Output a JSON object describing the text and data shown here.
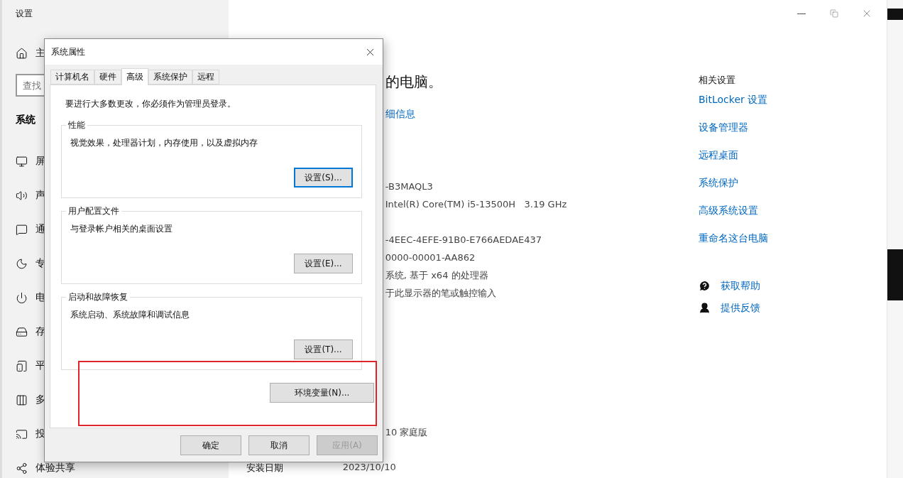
{
  "settings_window": {
    "title": "设置",
    "home_label": "主",
    "search": {
      "placeholder": "查找"
    },
    "section": "系统",
    "nav_items": [
      "屏",
      "声",
      "通",
      "专",
      "电",
      "存",
      "平",
      "多",
      "投",
      "体验共享"
    ],
    "heading": "的电脑。",
    "details_link": "细信息",
    "spec_groups": [
      [
        "-B3MAQL3",
        "Intel(R) Core(TM) i5-13500H   3.19 GHz"
      ],
      [
        "-4EEC-4EFE-91B0-E766AEDAE437",
        "0000-00001-AA862",
        "系统, 基于 x64 的处理器",
        "于此显示器的笔或触控输入"
      ],
      [
        "10 家庭版"
      ]
    ],
    "install_date": {
      "label": "安装日期",
      "value": "2023/10/10"
    },
    "related_title": "相关设置",
    "related_links": [
      "BitLocker 设置",
      "设备管理器",
      "远程桌面",
      "系统保护",
      "高级系统设置",
      "重命名这台电脑"
    ],
    "help_links": [
      "获取帮助",
      "提供反馈"
    ]
  },
  "dialog": {
    "title": "系统属性",
    "tabs": [
      {
        "label": "计算机名",
        "selected": false
      },
      {
        "label": "硬件",
        "selected": false
      },
      {
        "label": "高级",
        "selected": true
      },
      {
        "label": "系统保护",
        "selected": false
      },
      {
        "label": "远程",
        "selected": false
      }
    ],
    "notice": "要进行大多数更改，你必须作为管理员登录。",
    "groups": [
      {
        "title": "性能",
        "text": "视觉效果，处理器计划，内存使用，以及虚拟内存",
        "button": "设置(S)...",
        "focused": true
      },
      {
        "title": "用户配置文件",
        "text": "与登录帐户相关的桌面设置",
        "button": "设置(E)...",
        "focused": false
      },
      {
        "title": "启动和故障恢复",
        "text": "系统启动、系统故障和调试信息",
        "button": "设置(T)...",
        "focused": false
      }
    ],
    "env_button": "环境变量(N)...",
    "buttons": [
      {
        "label": "确定",
        "disabled": false
      },
      {
        "label": "取消",
        "disabled": false
      },
      {
        "label": "应用(A)",
        "disabled": true
      }
    ]
  }
}
